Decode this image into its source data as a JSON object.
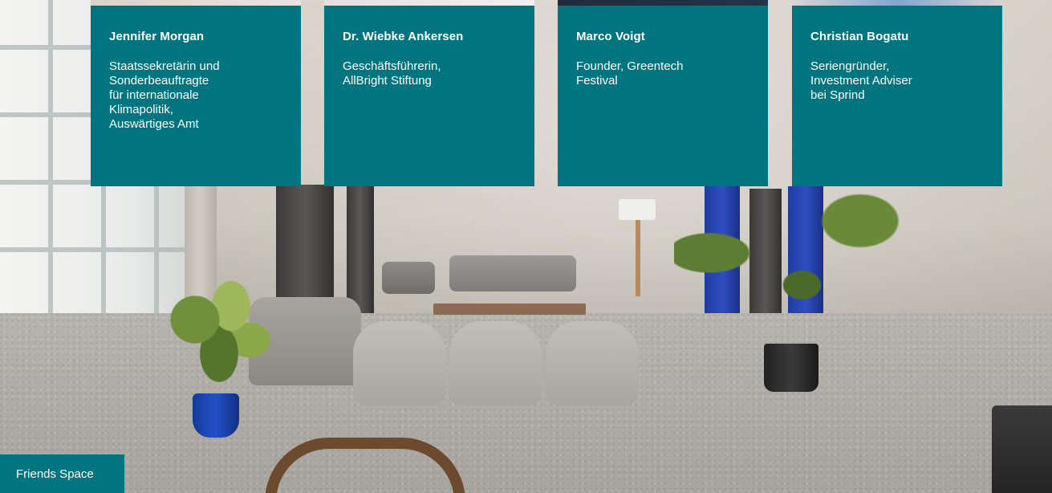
{
  "speakers": [
    {
      "name": "Jennifer Morgan",
      "role": "Staatssekretärin und\nSonderbeauftragte\nfür internationale\nKlimapolitik,\nAuswärtiges Amt"
    },
    {
      "name": "Dr. Wiebke Ankersen",
      "role": "Geschäftsführerin,\nAllBright Stiftung"
    },
    {
      "name": "Marco Voigt",
      "role": "Founder, Greentech\nFestival"
    },
    {
      "name": "Christian Bogatu",
      "role": "Seriengründer,\nInvestment Adviser\nbei Sprind"
    }
  ],
  "venue_label": "Friends Space",
  "colors": {
    "card_bg": "#00757f",
    "card_text": "#ffffff"
  }
}
